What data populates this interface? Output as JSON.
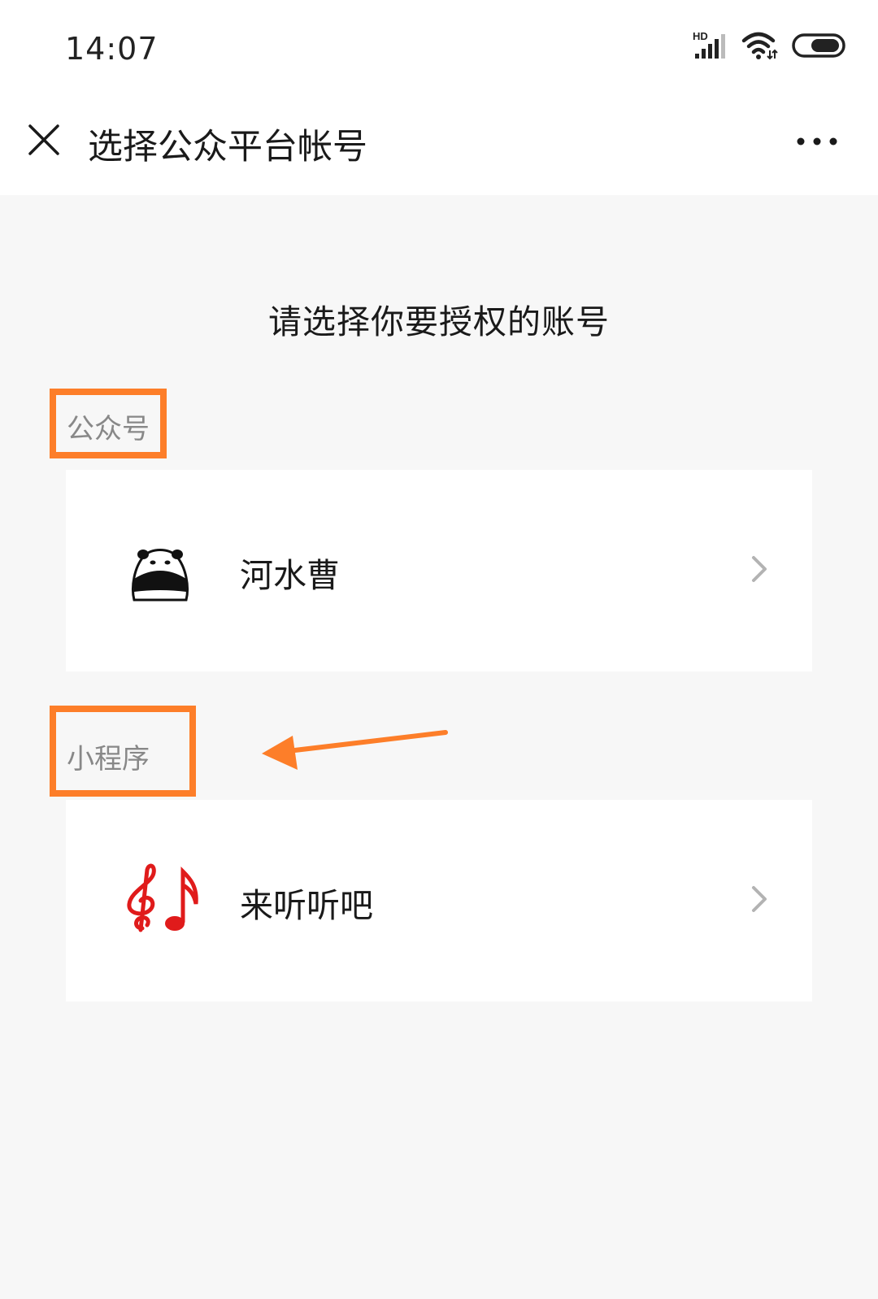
{
  "status_bar": {
    "time": "14:07",
    "network_badge": "HD",
    "icons": [
      "signal-icon",
      "wifi-icon",
      "battery-icon"
    ]
  },
  "nav": {
    "title": "选择公众平台帐号",
    "close_icon": "close-icon",
    "more_icon": "more-dots-icon"
  },
  "prompt": "请选择你要授权的账号",
  "sections": [
    {
      "label": "公众号",
      "account": {
        "name": "河水曹",
        "avatar_icon": "panda-avatar-icon"
      }
    },
    {
      "label": "小程序",
      "account": {
        "name": "来听听吧",
        "avatar_icon": "music-notes-icon"
      }
    }
  ],
  "colors": {
    "annotation": "#fd7e29",
    "page_background": "#f7f7f7",
    "card_background": "#ffffff",
    "section_label": "#888888",
    "music_icon": "#e01b1b"
  }
}
